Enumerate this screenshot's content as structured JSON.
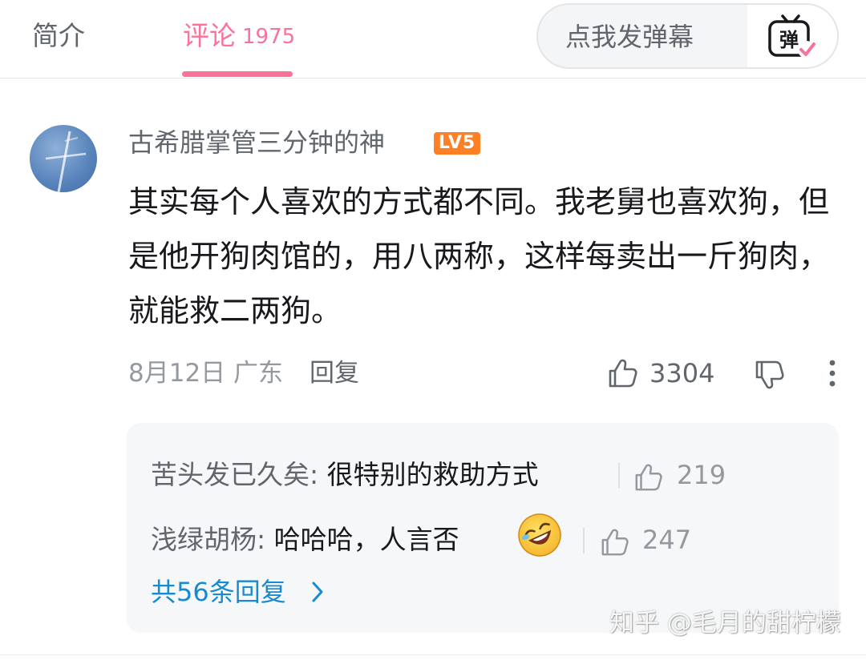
{
  "tabs": {
    "intro_label": "简介",
    "comments_label": "评论",
    "comments_count": "1975"
  },
  "danmaku": {
    "placeholder": "点我发弹幕",
    "button_glyph": "弹"
  },
  "comment": {
    "username": "古希腊掌管三分钟的神",
    "level": "LV5",
    "text": "其实每个人喜欢的方式都不同。我老舅也喜欢狗，但是他开狗肉馆的，用八两称，这样每卖出一斤狗肉，就能救二两狗。",
    "date_location": "8月12日 广东",
    "reply_label": "回复",
    "like_count": "3304"
  },
  "replies": [
    {
      "user": "苦头发已久矣",
      "text": "很特别的救助方式",
      "likes": "219"
    },
    {
      "user": "浅绿胡杨",
      "text": "哈哈哈，人言否",
      "likes": "247"
    }
  ],
  "more_replies": "共56条回复",
  "watermark": "知乎 @毛月的甜柠檬",
  "colors": {
    "accent_pink": "#fb7299",
    "link_blue": "#178bcf",
    "level_orange": "#ff7f24"
  },
  "icons": [
    "danmaku-icon",
    "thumbs-up-icon",
    "thumbs-down-icon",
    "more-vertical-icon",
    "chevron-right-icon",
    "laughing-emoji-icon"
  ]
}
